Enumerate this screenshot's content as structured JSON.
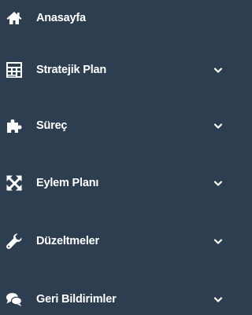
{
  "sidebar": {
    "background_color": "#2c3e50",
    "text_color": "#ffffff",
    "items": [
      {
        "label": "Anasayfa",
        "icon": "home-icon",
        "has_submenu": false
      },
      {
        "label": "Stratejik Plan",
        "icon": "calculator-icon",
        "has_submenu": true
      },
      {
        "label": "Süreç",
        "icon": "puzzle-icon",
        "has_submenu": true
      },
      {
        "label": "Eylem Planı",
        "icon": "expand-arrows-icon",
        "has_submenu": true
      },
      {
        "label": "Düzeltmeler",
        "icon": "wrench-icon",
        "has_submenu": true
      },
      {
        "label": "Geri Bildirimler",
        "icon": "comments-icon",
        "has_submenu": true
      }
    ]
  }
}
